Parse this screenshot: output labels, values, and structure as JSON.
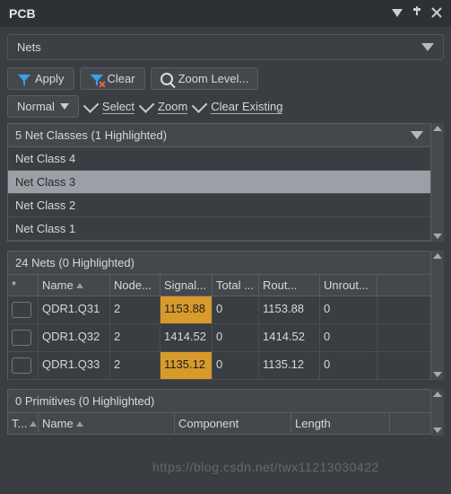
{
  "titlebar": {
    "title": "PCB"
  },
  "mainDropdown": {
    "label": "Nets"
  },
  "toolbar": {
    "apply": "Apply",
    "clear": "Clear",
    "zoom": "Zoom Level..."
  },
  "toolbar2": {
    "mode": "Normal",
    "select": "Select",
    "zoom": "Zoom",
    "clearExisting": "Clear Existing"
  },
  "netClasses": {
    "header": "5 Net Classes (1 Highlighted)",
    "items": [
      "Net Class 4",
      "Net Class 3",
      "Net Class 2",
      "Net Class 1"
    ],
    "selectedIndex": 1
  },
  "nets": {
    "header": "24 Nets (0 Highlighted)",
    "columns": [
      "*",
      "Name",
      "Node...",
      "Signal...",
      "Total ...",
      "Rout...",
      "Unrout..."
    ],
    "rows": [
      {
        "name": "QDR1.Q31",
        "node": "2",
        "signal": "1153.88",
        "total": "0",
        "rout": "1153.88",
        "unrout": "0",
        "signalHL": true
      },
      {
        "name": "QDR1.Q32",
        "node": "2",
        "signal": "1414.52",
        "total": "0",
        "rout": "1414.52",
        "unrout": "0",
        "signalHL": false
      },
      {
        "name": "QDR1.Q33",
        "node": "2",
        "signal": "1135.12",
        "total": "0",
        "rout": "1135.12",
        "unrout": "0",
        "signalHL": true
      }
    ]
  },
  "primitives": {
    "header": "0 Primitives (0 Highlighted)",
    "columns": [
      "T...",
      "Name",
      "Component",
      "Length"
    ]
  },
  "watermark": "https://blog.csdn.net/twx11213030422"
}
